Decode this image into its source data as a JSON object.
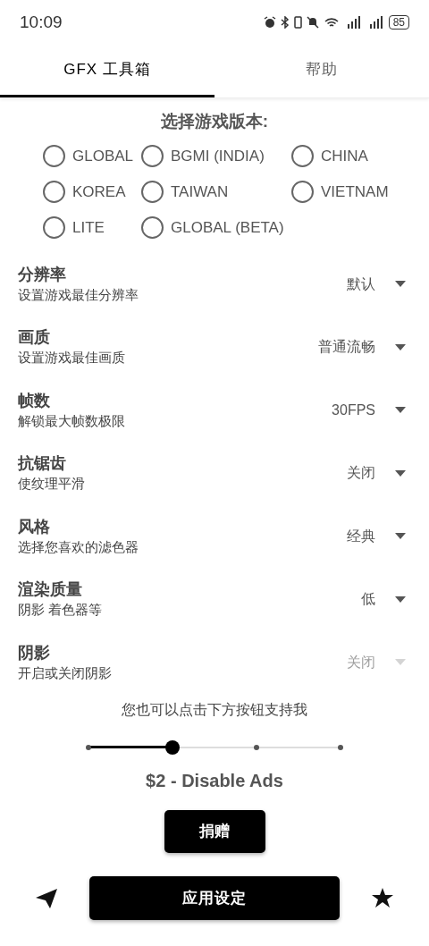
{
  "status_bar": {
    "time": "10:09",
    "battery": "85"
  },
  "tabs": [
    {
      "label": "GFX 工具箱",
      "selected": true
    },
    {
      "label": "帮助",
      "selected": false
    }
  ],
  "version_title": "选择游戏版本:",
  "versions": [
    {
      "label": "GLOBAL",
      "selected": false
    },
    {
      "label": "BGMI (INDIA)",
      "selected": false
    },
    {
      "label": "CHINA",
      "selected": false
    },
    {
      "label": "KOREA",
      "selected": false
    },
    {
      "label": "TAIWAN",
      "selected": false
    },
    {
      "label": "VIETNAM",
      "selected": false
    },
    {
      "label": "LITE",
      "selected": false
    },
    {
      "label": "GLOBAL (BETA)",
      "selected": false
    }
  ],
  "settings": [
    {
      "title": "分辨率",
      "subtitle": "设置游戏最佳分辨率",
      "value": "默认",
      "disabled": false
    },
    {
      "title": "画质",
      "subtitle": "设置游戏最佳画质",
      "value": "普通流畅",
      "disabled": false
    },
    {
      "title": "帧数",
      "subtitle": "解锁最大帧数极限",
      "value": "30FPS",
      "disabled": false
    },
    {
      "title": "抗锯齿",
      "subtitle": "使纹理平滑",
      "value": "关闭",
      "disabled": false
    },
    {
      "title": "风格",
      "subtitle": "选择您喜欢的滤色器",
      "value": "经典",
      "disabled": false
    },
    {
      "title": "渲染质量",
      "subtitle": "阴影 着色器等",
      "value": "低",
      "disabled": false
    },
    {
      "title": "阴影",
      "subtitle": "开启或关闭阴影",
      "value": "关闭",
      "disabled": true
    }
  ],
  "support": {
    "text": "您也可以点击下方按钮支持我",
    "slider": {
      "level": 0.3333
    },
    "price": "$2 - Disable Ads",
    "donate": "捐赠"
  },
  "apply_button": "应用设定"
}
